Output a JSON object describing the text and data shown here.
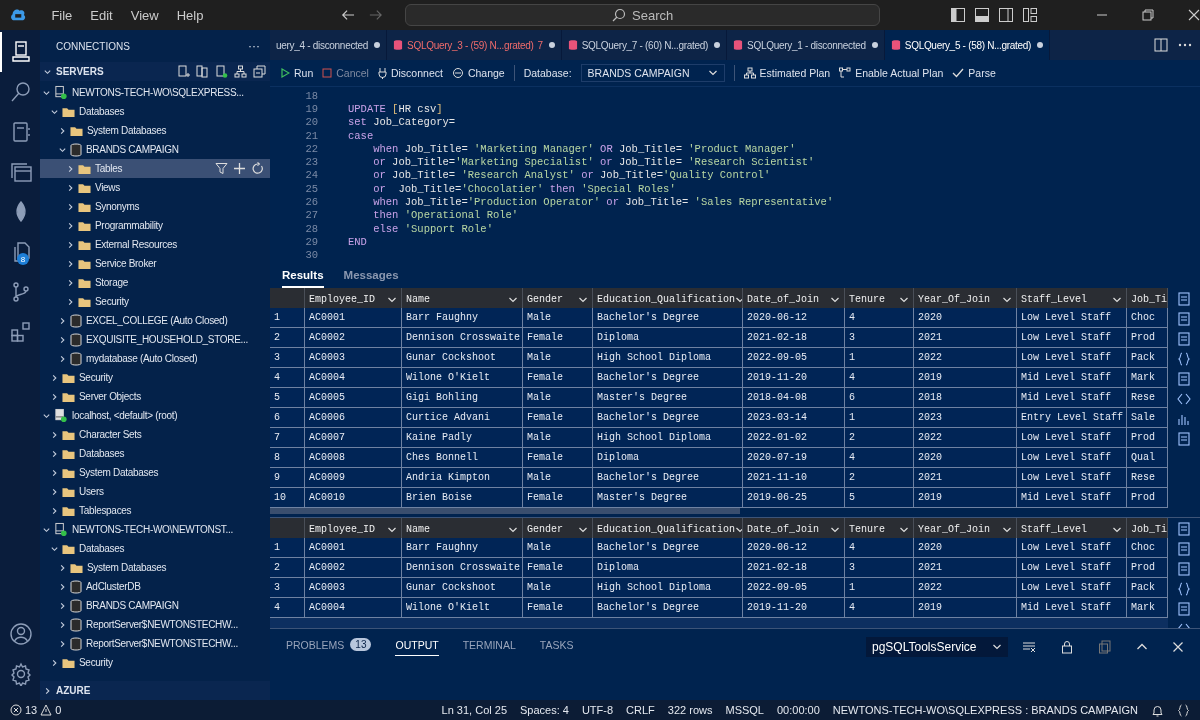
{
  "menu": [
    "File",
    "Edit",
    "View",
    "Help"
  ],
  "search": {
    "placeholder": "Search"
  },
  "activity_bar": [
    {
      "kind": "connections",
      "selected": true
    },
    {
      "kind": "search",
      "selected": false
    },
    {
      "kind": "notebook",
      "selected": false
    },
    {
      "kind": "windows",
      "selected": false
    },
    {
      "kind": "leaf",
      "selected": false
    },
    {
      "kind": "files",
      "selected": false,
      "badge": "8"
    },
    {
      "kind": "branch",
      "selected": false
    },
    {
      "kind": "extensions",
      "selected": false
    },
    {
      "kind": "account",
      "selected": false
    },
    {
      "kind": "settings",
      "selected": false
    }
  ],
  "sidebar": {
    "title": "CONNECTIONS",
    "more": "···",
    "sections": [
      {
        "label": "SERVERS",
        "expanded": true,
        "nodes": [
          {
            "label": "NEWTONS-TECH-WO\\SQLEXPRESS...",
            "kind": "server",
            "connected": true,
            "expanded": true,
            "selected": false,
            "children": [
              {
                "label": "Databases",
                "kind": "folder",
                "expanded": true,
                "selected": false,
                "children": [
                  {
                    "label": "System Databases",
                    "kind": "folder",
                    "expanded": false,
                    "selected": false
                  },
                  {
                    "label": "BRANDS CAMPAIGN",
                    "kind": "database",
                    "expanded": true,
                    "selected": false,
                    "children": [
                      {
                        "label": "Tables",
                        "kind": "folder",
                        "expanded": false,
                        "selected": true
                      },
                      {
                        "label": "Views",
                        "kind": "folder",
                        "expanded": false,
                        "selected": false
                      },
                      {
                        "label": "Synonyms",
                        "kind": "folder",
                        "expanded": false,
                        "selected": false
                      },
                      {
                        "label": "Programmability",
                        "kind": "folder",
                        "expanded": false,
                        "selected": false
                      },
                      {
                        "label": "External Resources",
                        "kind": "folder",
                        "expanded": false,
                        "selected": false
                      },
                      {
                        "label": "Service Broker",
                        "kind": "folder",
                        "expanded": false,
                        "selected": false
                      },
                      {
                        "label": "Storage",
                        "kind": "folder",
                        "expanded": false,
                        "selected": false
                      },
                      {
                        "label": "Security",
                        "kind": "folder",
                        "expanded": false,
                        "selected": false
                      }
                    ]
                  },
                  {
                    "label": "EXCEL_COLLEGE (Auto Closed)",
                    "kind": "database",
                    "expanded": false,
                    "selected": false
                  },
                  {
                    "label": "EXQUISITE_HOUSEHOLD_STORE...",
                    "kind": "database",
                    "expanded": false,
                    "selected": false
                  },
                  {
                    "label": "mydatabase (Auto Closed)",
                    "kind": "database",
                    "expanded": false,
                    "selected": false
                  }
                ]
              },
              {
                "label": "Security",
                "kind": "folder",
                "expanded": false,
                "selected": false
              },
              {
                "label": "Server Objects",
                "kind": "folder",
                "expanded": false,
                "selected": false
              }
            ]
          },
          {
            "label": "localhost, <default> (root)",
            "kind": "mysql-server",
            "connected": true,
            "expanded": true,
            "selected": false,
            "children": [
              {
                "label": "Character Sets",
                "kind": "folder",
                "expanded": false,
                "selected": false
              },
              {
                "label": "Databases",
                "kind": "folder",
                "expanded": false,
                "selected": false
              },
              {
                "label": "System Databases",
                "kind": "folder",
                "expanded": false,
                "selected": false
              },
              {
                "label": "Users",
                "kind": "folder",
                "expanded": false,
                "selected": false
              },
              {
                "label": "Tablespaces",
                "kind": "folder",
                "expanded": false,
                "selected": false
              }
            ]
          },
          {
            "label": "NEWTONS-TECH-WO\\NEWTONST...",
            "kind": "server",
            "connected": true,
            "expanded": true,
            "selected": false,
            "children": [
              {
                "label": "Databases",
                "kind": "folder",
                "expanded": true,
                "selected": false,
                "children": [
                  {
                    "label": "System Databases",
                    "kind": "folder",
                    "expanded": false,
                    "selected": false
                  },
                  {
                    "label": "AdClusterDB",
                    "kind": "database",
                    "expanded": false,
                    "selected": false
                  },
                  {
                    "label": "BRANDS CAMPAIGN",
                    "kind": "database",
                    "expanded": false,
                    "selected": false
                  },
                  {
                    "label": "ReportServer$NEWTONSTECHW...",
                    "kind": "database",
                    "expanded": false,
                    "selected": false
                  },
                  {
                    "label": "ReportServer$NEWTONSTECHW...",
                    "kind": "database",
                    "expanded": false,
                    "selected": false
                  }
                ]
              },
              {
                "label": "Security",
                "kind": "folder",
                "expanded": false,
                "selected": false
              }
            ]
          }
        ]
      },
      {
        "label": "AZURE",
        "expanded": false
      }
    ]
  },
  "tabs": [
    {
      "label": "uery_4 - disconnected",
      "icon": false,
      "has_errors": false,
      "dirty": true,
      "selected": false
    },
    {
      "label": "SQLQuery_3 - (59) N...grated)",
      "problems": "7",
      "icon": true,
      "has_errors": true,
      "dirty": true,
      "selected": false
    },
    {
      "label": "SQLQuery_7 - (60) N...grated)",
      "icon": true,
      "has_errors": false,
      "dirty": true,
      "selected": false
    },
    {
      "label": "SQLQuery_1 - disconnected",
      "icon": true,
      "has_errors": false,
      "dirty": true,
      "selected": false
    },
    {
      "label": "SQLQuery_5 - (58) N...grated)",
      "icon": true,
      "has_errors": false,
      "dirty": true,
      "selected": true
    }
  ],
  "toolbar": {
    "run": "Run",
    "cancel": {
      "label": "Cancel",
      "disabled": true
    },
    "disconnect": "Disconnect",
    "change": "Change",
    "database_label": "Database:",
    "database": "BRANDS CAMPAIGN",
    "estimated_plan": "Estimated Plan",
    "actual_plan": "Enable Actual Plan",
    "parse": "Parse"
  },
  "code": [
    {
      "number": "18"
    },
    {
      "number": "19",
      "tokens": [
        {
          "kind": "keyword",
          "text": "UPDATE"
        },
        {
          "kind": "bracket",
          "text": " ["
        },
        {
          "kind": "plain",
          "text": "HR csv"
        },
        {
          "kind": "bracket",
          "text": "]"
        }
      ]
    },
    {
      "number": "20",
      "tokens": [
        {
          "kind": "keyword",
          "text": "set"
        },
        {
          "kind": "plain",
          "text": " Job_Category="
        }
      ]
    },
    {
      "number": "21",
      "tokens": [
        {
          "kind": "keyword",
          "text": "case"
        }
      ]
    },
    {
      "number": "22",
      "tokens": [
        {
          "kind": "keyword",
          "text": "    when"
        },
        {
          "kind": "plain",
          "text": " Job_Title= "
        },
        {
          "kind": "string",
          "text": "'Marketing Manager'"
        },
        {
          "kind": "keyword",
          "text": " OR"
        },
        {
          "kind": "plain",
          "text": " Job_Title= "
        },
        {
          "kind": "string",
          "text": "'Product Manager'"
        }
      ]
    },
    {
      "number": "23",
      "tokens": [
        {
          "kind": "keyword",
          "text": "    or"
        },
        {
          "kind": "plain",
          "text": " Job_Title="
        },
        {
          "kind": "string",
          "text": "'Marketing Specialist'"
        },
        {
          "kind": "keyword",
          "text": " or"
        },
        {
          "kind": "plain",
          "text": " Job_Title= "
        },
        {
          "kind": "string",
          "text": "'Research Scientist'"
        }
      ]
    },
    {
      "number": "24",
      "tokens": [
        {
          "kind": "keyword",
          "text": "    or"
        },
        {
          "kind": "plain",
          "text": " Job_Title= "
        },
        {
          "kind": "string",
          "text": "'Research Analyst'"
        },
        {
          "kind": "keyword",
          "text": " or"
        },
        {
          "kind": "plain",
          "text": " Job_Title="
        },
        {
          "kind": "string",
          "text": "'Quality Control'"
        }
      ]
    },
    {
      "number": "25",
      "tokens": [
        {
          "kind": "keyword",
          "text": "    or"
        },
        {
          "kind": "plain",
          "text": "  Job_Title="
        },
        {
          "kind": "string",
          "text": "'Chocolatier'"
        },
        {
          "kind": "keyword",
          "text": " then"
        },
        {
          "kind": "string",
          "text": " 'Special Roles'"
        }
      ]
    },
    {
      "number": "26",
      "tokens": [
        {
          "kind": "keyword",
          "text": "    when"
        },
        {
          "kind": "plain",
          "text": " Job_Title="
        },
        {
          "kind": "string",
          "text": "'Production Operator'"
        },
        {
          "kind": "keyword",
          "text": " or"
        },
        {
          "kind": "plain",
          "text": " Job_Title= "
        },
        {
          "kind": "string",
          "text": "'Sales Representative'"
        }
      ]
    },
    {
      "number": "27",
      "tokens": [
        {
          "kind": "keyword",
          "text": "    then"
        },
        {
          "kind": "string",
          "text": " 'Operational Role'"
        }
      ]
    },
    {
      "number": "28",
      "tokens": [
        {
          "kind": "keyword",
          "text": "    else"
        },
        {
          "kind": "string",
          "text": " 'Support Role'"
        }
      ]
    },
    {
      "number": "29",
      "tokens": [
        {
          "kind": "keyword",
          "text": "END"
        }
      ]
    },
    {
      "number": "30"
    }
  ],
  "results": {
    "tabs": [
      {
        "label": "Results",
        "selected": true
      },
      {
        "label": "Messages",
        "selected": false
      }
    ],
    "grids": [
      {
        "columns": [
          "Employee_ID",
          "Name",
          "Gender",
          "Education_Qualification",
          "Date_of_Join",
          "Tenure",
          "Year_Of_Join",
          "Staff_Level",
          "Job_Ti"
        ],
        "rows": [
          {
            "number": "1",
            "cells": [
              "AC0001",
              "Barr Faughny",
              "Male",
              "Bachelor's Degree",
              "2020-06-12",
              "4",
              "2020",
              "Low Level Staff",
              "Choc"
            ]
          },
          {
            "number": "2",
            "cells": [
              "AC0002",
              "Dennison Crosswaite",
              "Female",
              "Diploma",
              "2021-02-18",
              "3",
              "2021",
              "Low Level Staff",
              "Prod"
            ]
          },
          {
            "number": "3",
            "cells": [
              "AC0003",
              "Gunar Cockshoot",
              "Male",
              "High School Diploma",
              "2022-09-05",
              "1",
              "2022",
              "Low Level Staff",
              "Pack"
            ]
          },
          {
            "number": "4",
            "cells": [
              "AC0004",
              "Wilone O'Kielt",
              "Female",
              "Bachelor's Degree",
              "2019-11-20",
              "4",
              "2019",
              "Mid Level Staff",
              "Mark"
            ]
          },
          {
            "number": "5",
            "cells": [
              "AC0005",
              "Gigi Bohling",
              "Male",
              "Master's Degree",
              "2018-04-08",
              "6",
              "2018",
              "Mid Level Staff",
              "Rese"
            ]
          },
          {
            "number": "6",
            "cells": [
              "AC0006",
              "Curtice Advani",
              "Female",
              "Bachelor's Degree",
              "2023-03-14",
              "1",
              "2023",
              "Entry Level Staff",
              "Sale"
            ]
          },
          {
            "number": "7",
            "cells": [
              "AC0007",
              "Kaine Padly",
              "Male",
              "High School Diploma",
              "2022-01-02",
              "2",
              "2022",
              "Low Level Staff",
              "Prod"
            ]
          },
          {
            "number": "8",
            "cells": [
              "AC0008",
              "Ches Bonnell",
              "Female",
              "Diploma",
              "2020-07-19",
              "4",
              "2020",
              "Low Level Staff",
              "Qual"
            ]
          },
          {
            "number": "9",
            "cells": [
              "AC0009",
              "Andria Kimpton",
              "Male",
              "Bachelor's Degree",
              "2021-11-10",
              "2",
              "2021",
              "Low Level Staff",
              "Rese"
            ]
          },
          {
            "number": "10",
            "cells": [
              "AC0010",
              "Brien Boise",
              "Female",
              "Master's Degree",
              "2019-06-25",
              "5",
              "2019",
              "Mid Level Staff",
              "Prod"
            ]
          }
        ]
      },
      {
        "columns": [
          "Employee_ID",
          "Name",
          "Gender",
          "Education_Qualification",
          "Date_of_Join",
          "Tenure",
          "Year_Of_Join",
          "Staff_Level",
          "Job_Ti"
        ],
        "rows": [
          {
            "number": "1",
            "cells": [
              "AC0001",
              "Barr Faughny",
              "Male",
              "Bachelor's Degree",
              "2020-06-12",
              "4",
              "2020",
              "Low Level Staff",
              "Choc"
            ]
          },
          {
            "number": "2",
            "cells": [
              "AC0002",
              "Dennison Crosswaite",
              "Female",
              "Diploma",
              "2021-02-18",
              "3",
              "2021",
              "Low Level Staff",
              "Prod"
            ]
          },
          {
            "number": "3",
            "cells": [
              "AC0003",
              "Gunar Cockshoot",
              "Male",
              "High School Diploma",
              "2022-09-05",
              "1",
              "2022",
              "Low Level Staff",
              "Pack"
            ]
          },
          {
            "number": "4",
            "cells": [
              "AC0004",
              "Wilone O'Kielt",
              "Female",
              "Bachelor's Degree",
              "2019-11-20",
              "4",
              "2019",
              "Mid Level Staff",
              "Mark"
            ]
          }
        ]
      }
    ]
  },
  "panel": {
    "tabs": [
      {
        "label": "PROBLEMS",
        "badge": "13",
        "selected": false
      },
      {
        "label": "OUTPUT",
        "selected": true
      },
      {
        "label": "TERMINAL",
        "selected": false
      },
      {
        "label": "TASKS",
        "selected": false
      }
    ],
    "channel": "pgSQLToolsService"
  },
  "status_bar": {
    "errors": "13",
    "warnings": "0",
    "items": [
      "Ln 31, Col 25",
      "Spaces: 4",
      "UTF-8",
      "CRLF",
      "322 rows",
      "MSSQL",
      "00:00:00",
      "NEWTONS-TECH-WO\\SQLEXPRESS : BRANDS CAMPAIGN"
    ]
  }
}
